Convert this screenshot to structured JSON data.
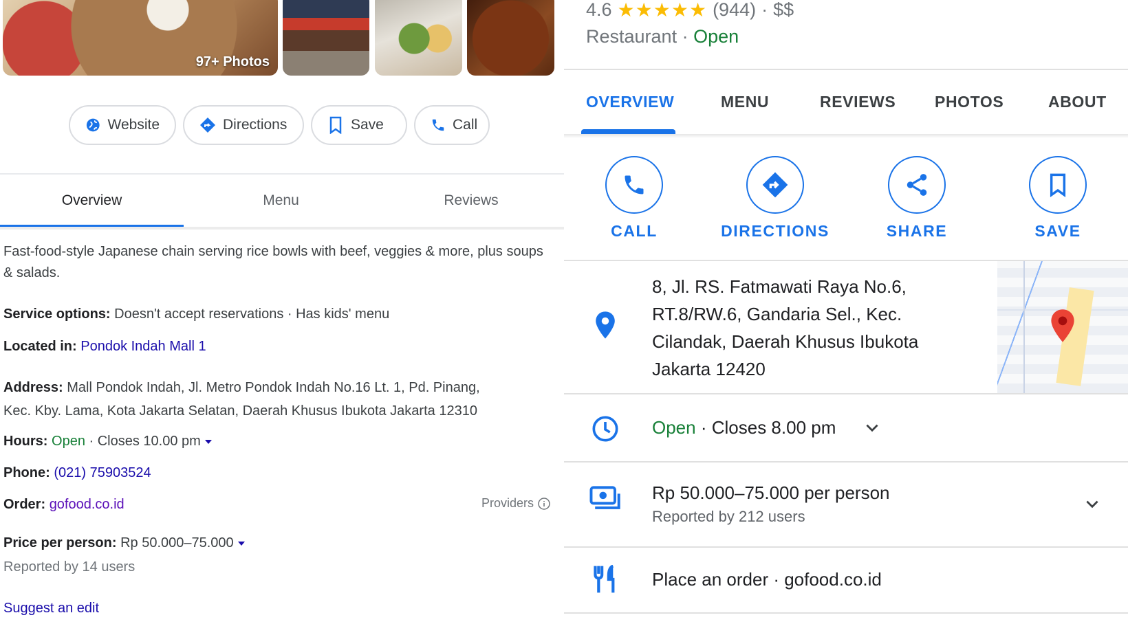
{
  "left": {
    "photo_count": "97+ Photos",
    "chips": {
      "website": "Website",
      "directions": "Directions",
      "save": "Save",
      "call": "Call"
    },
    "tabs": [
      "Overview",
      "Menu",
      "Reviews"
    ],
    "description": "Fast-food-style Japanese chain serving rice bowls with beef, veggies & more, plus soups & salads.",
    "service_label": "Service options:",
    "service_value": "Doesn't accept reservations · Has kids' menu",
    "located_label": "Located in:",
    "located_value": "Pondok Indah Mall 1",
    "address_label": "Address:",
    "address_line1": "Mall Pondok Indah, Jl. Metro Pondok Indah No.16 Lt. 1, Pd. Pinang,",
    "address_line2": "Kec. Kby. Lama, Kota Jakarta Selatan, Daerah Khusus Ibukota Jakarta 12310",
    "hours_label": "Hours:",
    "hours_open": "Open",
    "hours_value": "· Closes 10.00 pm",
    "phone_label": "Phone:",
    "phone_value": "(021) 75903524",
    "order_label": "Order:",
    "order_value": "gofood.co.id",
    "providers": "Providers",
    "price_label": "Price per person:",
    "price_value": "Rp 50.000–75.000",
    "price_reported": "Reported by 14 users",
    "suggest_edit": "Suggest an edit"
  },
  "right": {
    "rating": "4.6",
    "stars": "★★★★★",
    "review_count": "(944)",
    "price_level": "$$",
    "type": "Restaurant",
    "status": "Open",
    "tabs": [
      "OVERVIEW",
      "MENU",
      "REVIEWS",
      "PHOTOS",
      "ABOUT"
    ],
    "actions": [
      "CALL",
      "DIRECTIONS",
      "SHARE",
      "SAVE"
    ],
    "address_lines": [
      "8, Jl. RS. Fatmawati Raya No.6,",
      "RT.8/RW.6, Gandaria Sel., Kec.",
      "Cilandak, Daerah Khusus Ibukota",
      "Jakarta 12420"
    ],
    "hours_open": "Open",
    "hours_value": "· Closes 8.00 pm",
    "price_value": "Rp 50.000–75.000 per person",
    "price_reported": "Reported by 212 users",
    "order_value": "Place an order · gofood.co.id"
  },
  "colors": {
    "accent_blue": "#1a73e8",
    "link_blue": "#1a0dab",
    "open_green": "#188038",
    "star_yellow": "#fbbc04",
    "pin_red": "#ea4335"
  }
}
